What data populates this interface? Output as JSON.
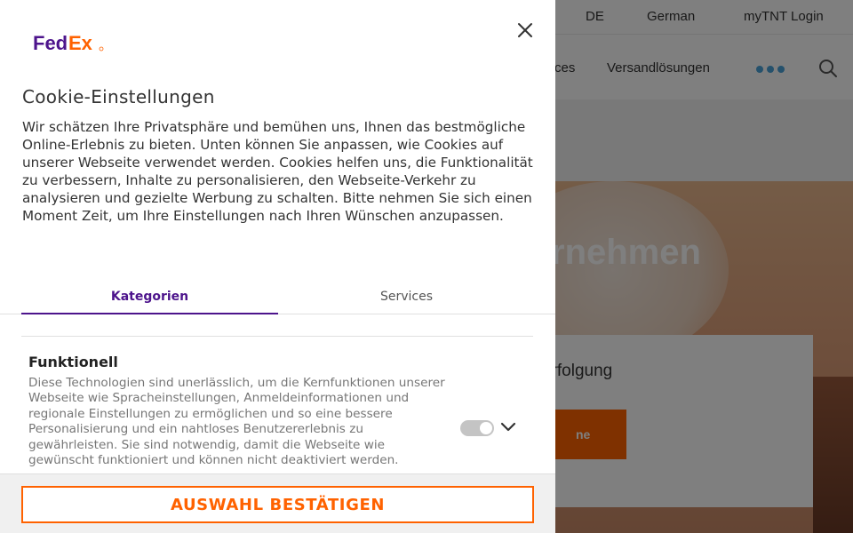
{
  "background": {
    "topbar": {
      "country": "DE",
      "language": "German",
      "login": "myTNT Login"
    },
    "nav": {
      "services_partial": "ces",
      "versand": "Versandlösungen"
    },
    "hero": {
      "title_partial": "nternehmen",
      "card_title_partial": "erfolgung",
      "card_button_partial": "ne"
    }
  },
  "panel": {
    "logo_fed": "Fed",
    "logo_ex": "Ex",
    "title": "Cookie-Einstellungen",
    "description": "Wir schätzen Ihre Privatsphäre und bemühen uns, Ihnen das bestmögliche Online-Erlebnis zu bieten. Unten können Sie anpassen, wie Cookies auf unserer Webseite verwendet werden. Cookies helfen uns, die Funktionalität zu verbessern, Inhalte zu personalisieren, den Webseite-Verkehr zu analysieren und gezielte Werbung zu schalten. Bitte nehmen Sie sich einen Moment Zeit, um Ihre Einstellungen nach Ihren Wünschen anzupassen.",
    "tabs": [
      {
        "label": "Kategorien",
        "active": true
      },
      {
        "label": "Services",
        "active": false
      }
    ],
    "category": {
      "title": "Funktionell",
      "description": "Diese Technologien sind unerlässlich, um die Kernfunktionen unserer Webseite wie Spracheinstellungen, Anmeldeinformationen und regionale Einstellungen zu ermöglichen und so eine bessere Personalisierung und ein nahtloses Benutzererlebnis zu gewährleisten. Sie sind notwendig, damit die Webseite wie gewünscht funktioniert und können nicht deaktiviert werden.",
      "toggle_on": true,
      "toggle_disabled": true
    },
    "confirm_button": "AUSWAHL BESTÄTIGEN"
  },
  "colors": {
    "fedex_purple": "#4d148c",
    "fedex_orange": "#ff6200",
    "text": "#333333",
    "muted_text": "#767676"
  },
  "icons": {
    "close": "close-icon",
    "chevron": "chevron-down-icon",
    "search": "search-icon",
    "more": "more-dots-icon"
  }
}
